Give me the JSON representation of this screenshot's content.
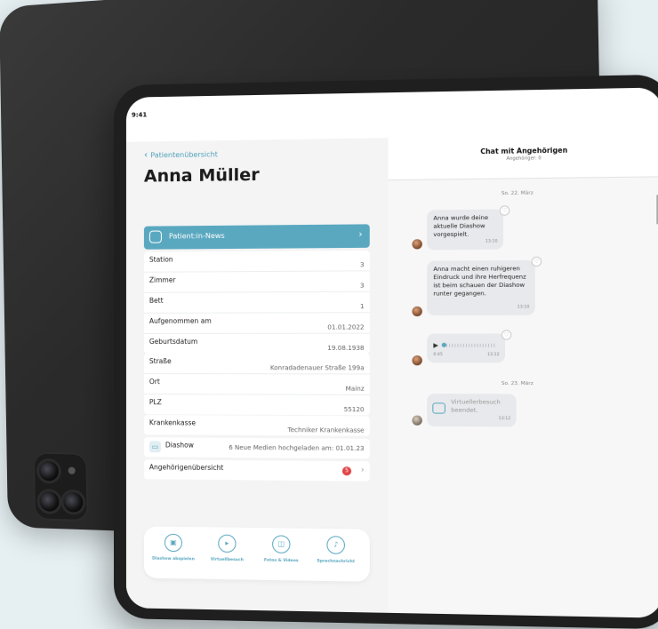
{
  "status": {
    "time": "9:41",
    "icons": "▪▪▪ ≋ ▬"
  },
  "nav": {
    "back_label": "Patientenübersicht"
  },
  "patient": {
    "name": "Anna Müller"
  },
  "news": {
    "label": "Patient:in-News"
  },
  "details": [
    {
      "label": "Station",
      "value": "3"
    },
    {
      "label": "Zimmer",
      "value": "3"
    },
    {
      "label": "Bett",
      "value": "1"
    },
    {
      "label": "Aufgenommen am",
      "value": "01.01.2022"
    },
    {
      "label": "Geburtsdatum",
      "value": "19.08.1938"
    }
  ],
  "address": [
    {
      "label": "Straße",
      "value": "Konradadenauer Straße 199a"
    },
    {
      "label": "Ort",
      "value": "Mainz"
    },
    {
      "label": "PLZ",
      "value": "55120"
    }
  ],
  "insurance": {
    "label": "Krankenkasse",
    "value": "Techniker Krankenkasse"
  },
  "slideshow": {
    "label": "Diashow",
    "value": "6 Neue Medien hochgeladen am: 01.01.23"
  },
  "relatives": {
    "label": "Angehörigenübersicht",
    "badge": "5"
  },
  "actions": [
    {
      "label": "Diashow abspielen"
    },
    {
      "label": "Virtuellbesuch"
    },
    {
      "label": "Fotos & Videos"
    },
    {
      "label": "Sprachnachricht"
    }
  ],
  "chat": {
    "title": "Chat mit Angehörigen",
    "subtitle": "Angehöriger: 0",
    "date1": "So. 22. März",
    "date2": "So. 23. März",
    "messages": [
      {
        "text": "Anna wurde deine aktuelle Diashow vorgespielt.",
        "time": "13:10"
      },
      {
        "text": "Anna macht einen ruhigeren Eindruck und ihre Herfrequenz ist beim schauen der Diashow runter gegangen.",
        "time": "13:10"
      },
      {
        "duration": "0:45",
        "time": "13:12"
      },
      {
        "text": "Virtuellerbesuch beendet.",
        "time": "13:12"
      }
    ]
  },
  "colors": {
    "accent": "#5aa8c0",
    "background": "#e6f0f3"
  }
}
